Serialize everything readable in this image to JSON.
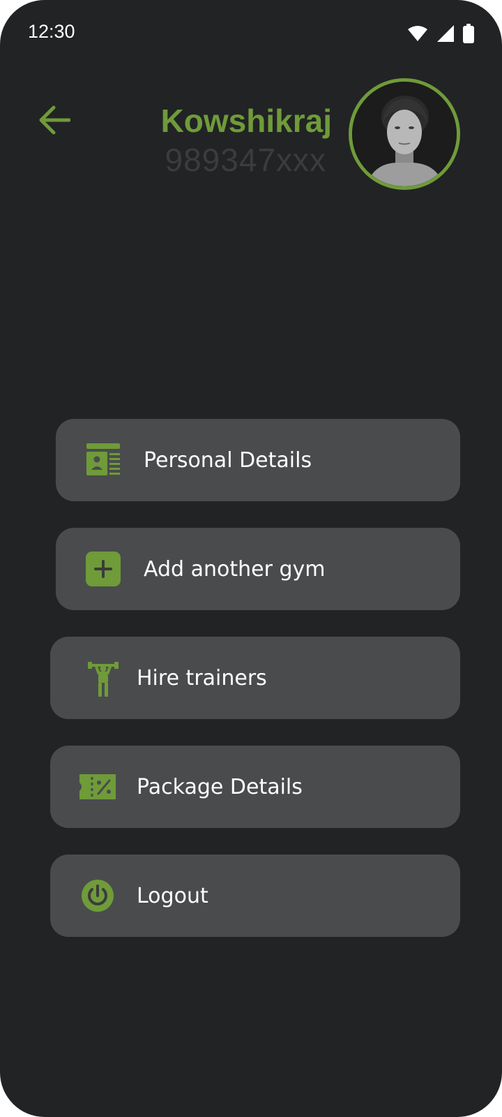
{
  "status_bar": {
    "time": "12:30",
    "icons": [
      "wifi-icon",
      "cellular-signal-icon",
      "battery-icon"
    ]
  },
  "header": {
    "back_icon": "arrow-left-icon",
    "name": "Kowshikraj",
    "phone": "989347xxx",
    "avatar_alt": "profile photo"
  },
  "menu": {
    "items": [
      {
        "label": "Personal Details",
        "icon": "id-card-icon"
      },
      {
        "label": "Add another gym",
        "icon": "plus-square-icon"
      },
      {
        "label": "Hire trainers",
        "icon": "weightlifter-icon"
      },
      {
        "label": "Package Details",
        "icon": "discount-ticket-icon"
      },
      {
        "label": "Logout",
        "icon": "power-icon"
      }
    ]
  },
  "colors": {
    "background": "#222325",
    "card": "#4a4b4d",
    "accent": "#6f9b39",
    "text": "#ffffff",
    "muted_text": "#3b3c3f"
  }
}
